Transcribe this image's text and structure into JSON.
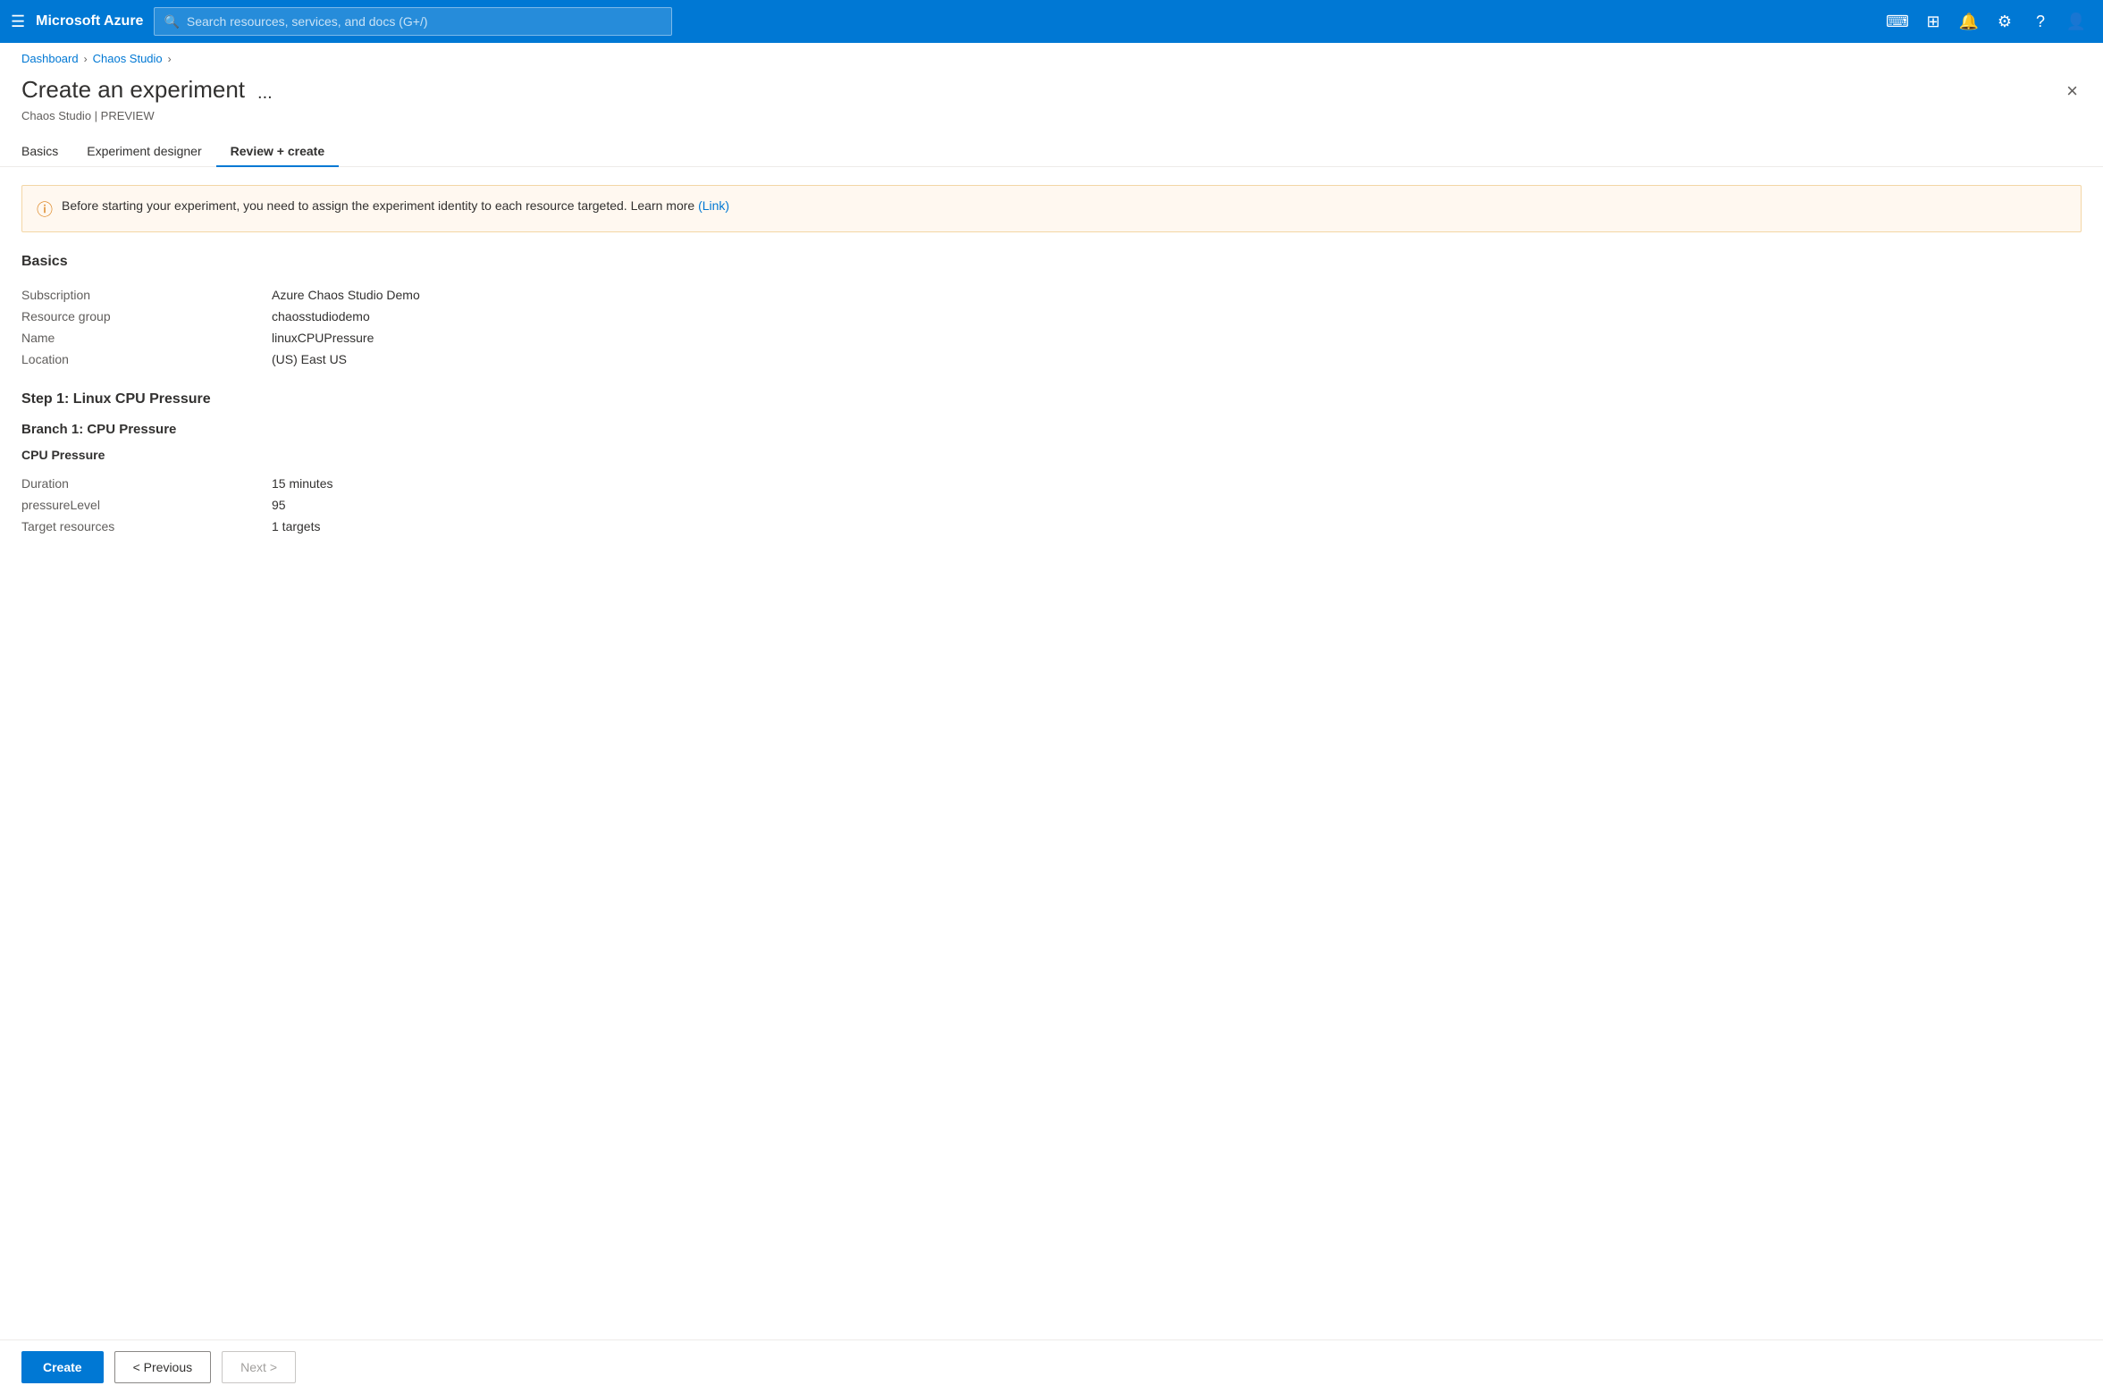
{
  "topbar": {
    "brand": "Microsoft Azure",
    "search_placeholder": "Search resources, services, and docs (G+/)"
  },
  "breadcrumbs": [
    {
      "label": "Dashboard",
      "link": true
    },
    {
      "label": "Chaos Studio",
      "link": true
    }
  ],
  "page": {
    "title": "Create an experiment",
    "subtitle": "Chaos Studio | PREVIEW",
    "menu_label": "...",
    "close_label": "×"
  },
  "tabs": [
    {
      "label": "Basics",
      "active": false
    },
    {
      "label": "Experiment designer",
      "active": false
    },
    {
      "label": "Review + create",
      "active": true
    }
  ],
  "banner": {
    "text": "Before starting your experiment, you need to assign the experiment identity to each resource targeted. Learn more",
    "link_text": "(Link)"
  },
  "basics_section": {
    "heading": "Basics",
    "fields": [
      {
        "label": "Subscription",
        "value": "Azure Chaos Studio Demo"
      },
      {
        "label": "Resource group",
        "value": "chaosstudiodemo"
      },
      {
        "label": "Name",
        "value": "linuxCPUPressure"
      },
      {
        "label": "Location",
        "value": "(US) East US"
      }
    ]
  },
  "step1": {
    "heading": "Step 1: Linux CPU Pressure",
    "branch1": {
      "heading": "Branch 1: CPU Pressure",
      "fault": {
        "heading": "CPU Pressure",
        "fields": [
          {
            "label": "Duration",
            "value": "15 minutes"
          },
          {
            "label": "pressureLevel",
            "value": "95"
          },
          {
            "label": "Target resources",
            "value": "1 targets"
          }
        ]
      }
    }
  },
  "buttons": {
    "create": "Create",
    "previous": "< Previous",
    "next": "Next >"
  }
}
